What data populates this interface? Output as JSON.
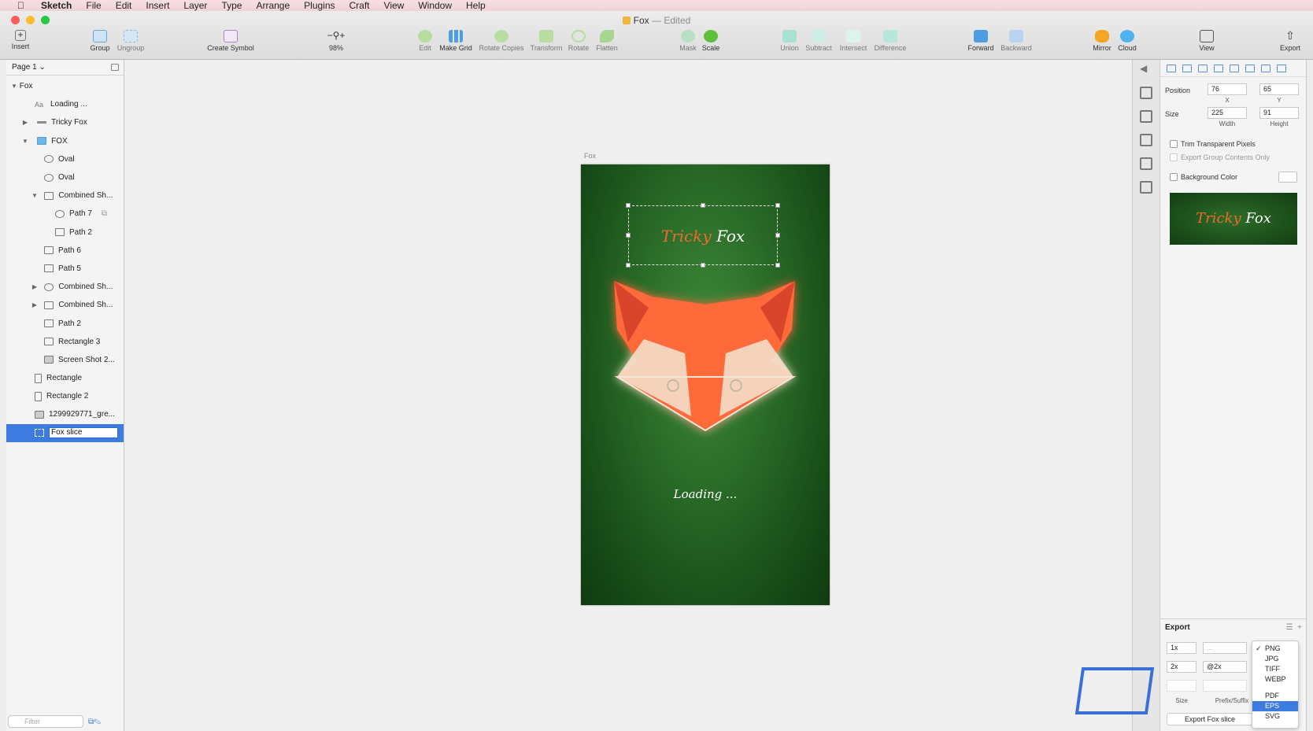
{
  "menubar": {
    "app": "Sketch",
    "items": [
      "File",
      "Edit",
      "Insert",
      "Layer",
      "Type",
      "Arrange",
      "Plugins",
      "Craft",
      "View",
      "Window",
      "Help"
    ]
  },
  "window": {
    "doc_name": "Fox",
    "edited": "— Edited"
  },
  "toolbar": {
    "insert": "Insert",
    "group": "Group",
    "ungroup": "Ungroup",
    "create_symbol": "Create Symbol",
    "zoom": "98%",
    "edit": "Edit",
    "make_grid": "Make Grid",
    "rotate_copies": "Rotate Copies",
    "transform": "Transform",
    "rotate": "Rotate",
    "flatten": "Flatten",
    "mask": "Mask",
    "scale": "Scale",
    "union": "Union",
    "subtract": "Subtract",
    "intersect": "Intersect",
    "difference": "Difference",
    "forward": "Forward",
    "backward": "Backward",
    "mirror": "Mirror",
    "cloud": "Cloud",
    "view": "View",
    "export": "Export"
  },
  "layers": {
    "page": "Page 1",
    "items": [
      {
        "label": "Fox",
        "icon": "artboard"
      },
      {
        "label": "Loading ...",
        "icon": "text"
      },
      {
        "label": "Tricky Fox",
        "icon": "symbol"
      },
      {
        "label": "FOX",
        "icon": "folder"
      },
      {
        "label": "Oval",
        "icon": "oval"
      },
      {
        "label": "Oval",
        "icon": "oval"
      },
      {
        "label": "Combined Sh...",
        "icon": "shape"
      },
      {
        "label": "Path 7",
        "icon": "path"
      },
      {
        "label": "Path 2",
        "icon": "path"
      },
      {
        "label": "Path 6",
        "icon": "path"
      },
      {
        "label": "Path 5",
        "icon": "path"
      },
      {
        "label": "Combined Sh...",
        "icon": "shape"
      },
      {
        "label": "Combined Sh...",
        "icon": "shape"
      },
      {
        "label": "Path 2",
        "icon": "path"
      },
      {
        "label": "Rectangle 3",
        "icon": "rect"
      },
      {
        "label": "Screen Shot 2...",
        "icon": "image"
      },
      {
        "label": "Rectangle",
        "icon": "rect"
      },
      {
        "label": "Rectangle 2",
        "icon": "rect"
      },
      {
        "label": "1299929771_gre...",
        "icon": "image"
      },
      {
        "label": "Fox slice",
        "icon": "slice"
      }
    ],
    "filter_placeholder": "Filter"
  },
  "canvas": {
    "artboard_label": "Fox",
    "brand_tricky": "Tricky",
    "brand_fox": "Fox",
    "loading": "Loading ..."
  },
  "inspector": {
    "position_label": "Position",
    "x": "76",
    "y": "65",
    "x_label": "X",
    "y_label": "Y",
    "size_label": "Size",
    "width": "225",
    "height": "91",
    "width_label": "Width",
    "height_label": "Height",
    "trim": "Trim Transparent Pixels",
    "export_group": "Export Group Contents Only",
    "bg_color": "Background Color",
    "preview_tricky": "Tricky",
    "preview_fox": "Fox",
    "export_title": "Export",
    "scale1": "1x",
    "scale2": "2x",
    "suffix1": "...",
    "suffix2": "@2x",
    "size_col": "Size",
    "prefix_col": "Prefix/Suffix",
    "export_button": "Export Fox slice"
  },
  "format_menu": {
    "options": [
      "PNG",
      "JPG",
      "TIFF",
      "WEBP",
      "PDF",
      "EPS",
      "SVG"
    ],
    "checked": "PNG",
    "highlighted": "EPS"
  },
  "colors": {
    "selection_blue": "#3d7be0",
    "fox_orange": "#ef6b2b",
    "artboard_green": "#2a6b28"
  }
}
